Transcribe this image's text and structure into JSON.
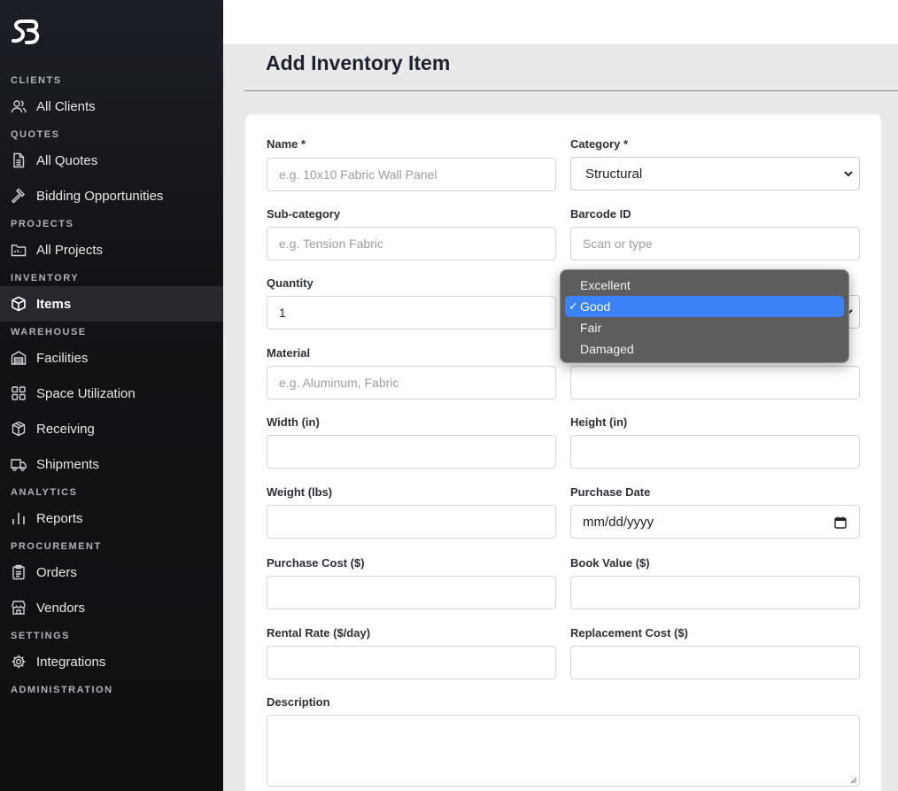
{
  "sidebar": {
    "logo_text": "SB",
    "sections": [
      {
        "label": "CLIENTS",
        "items": [
          {
            "label": "All Clients",
            "icon": "users-icon"
          }
        ]
      },
      {
        "label": "QUOTES",
        "items": [
          {
            "label": "All Quotes",
            "icon": "document-icon"
          },
          {
            "label": "Bidding Opportunities",
            "icon": "gavel-icon"
          }
        ]
      },
      {
        "label": "PROJECTS",
        "items": [
          {
            "label": "All Projects",
            "icon": "folder-icon"
          }
        ]
      },
      {
        "label": "INVENTORY",
        "items": [
          {
            "label": "Items",
            "icon": "cube-icon",
            "active": true
          }
        ]
      },
      {
        "label": "WAREHOUSE",
        "items": [
          {
            "label": "Facilities",
            "icon": "warehouse-icon"
          },
          {
            "label": "Space Utilization",
            "icon": "grid-icon"
          },
          {
            "label": "Receiving",
            "icon": "boxes-icon"
          },
          {
            "label": "Shipments",
            "icon": "truck-icon"
          }
        ]
      },
      {
        "label": "ANALYTICS",
        "items": [
          {
            "label": "Reports",
            "icon": "bar-chart-icon"
          }
        ]
      },
      {
        "label": "PROCUREMENT",
        "items": [
          {
            "label": "Orders",
            "icon": "clipboard-icon"
          },
          {
            "label": "Vendors",
            "icon": "store-icon"
          }
        ]
      },
      {
        "label": "SETTINGS",
        "items": [
          {
            "label": "Integrations",
            "icon": "gear-icon"
          }
        ]
      },
      {
        "label": "ADMINISTRATION",
        "items": []
      }
    ]
  },
  "page": {
    "title": "Add Inventory Item"
  },
  "form": {
    "name": {
      "label": "Name *",
      "placeholder": "e.g. 10x10 Fabric Wall Panel",
      "value": ""
    },
    "category": {
      "label": "Category *",
      "value": "Structural"
    },
    "subcategory": {
      "label": "Sub-category",
      "placeholder": "e.g. Tension Fabric",
      "value": ""
    },
    "barcode": {
      "label": "Barcode ID",
      "placeholder": "Scan or type",
      "value": ""
    },
    "quantity": {
      "label": "Quantity",
      "value": "1"
    },
    "material": {
      "label": "Material",
      "placeholder": "e.g. Aluminum, Fabric",
      "value": ""
    },
    "width": {
      "label": "Width (in)",
      "value": ""
    },
    "height": {
      "label": "Height (in)",
      "value": ""
    },
    "weight": {
      "label": "Weight (lbs)",
      "value": ""
    },
    "purchase_date": {
      "label": "Purchase Date",
      "value": "mm/dd/yyyy"
    },
    "purchase_cost": {
      "label": "Purchase Cost ($)",
      "value": ""
    },
    "book_value": {
      "label": "Book Value ($)",
      "value": ""
    },
    "rental_rate": {
      "label": "Rental Rate ($/day)",
      "value": ""
    },
    "replacement_cost": {
      "label": "Replacement Cost ($)",
      "value": ""
    },
    "description": {
      "label": "Description",
      "value": ""
    }
  },
  "condition_dropdown": {
    "options": [
      "Excellent",
      "Good",
      "Fair",
      "Damaged"
    ],
    "selected": "Good",
    "check_glyph": "✓"
  },
  "colors": {
    "sidebar_bg": "#121316",
    "accent_selected": "#3b82f6",
    "page_bg": "#e9e9e9"
  }
}
